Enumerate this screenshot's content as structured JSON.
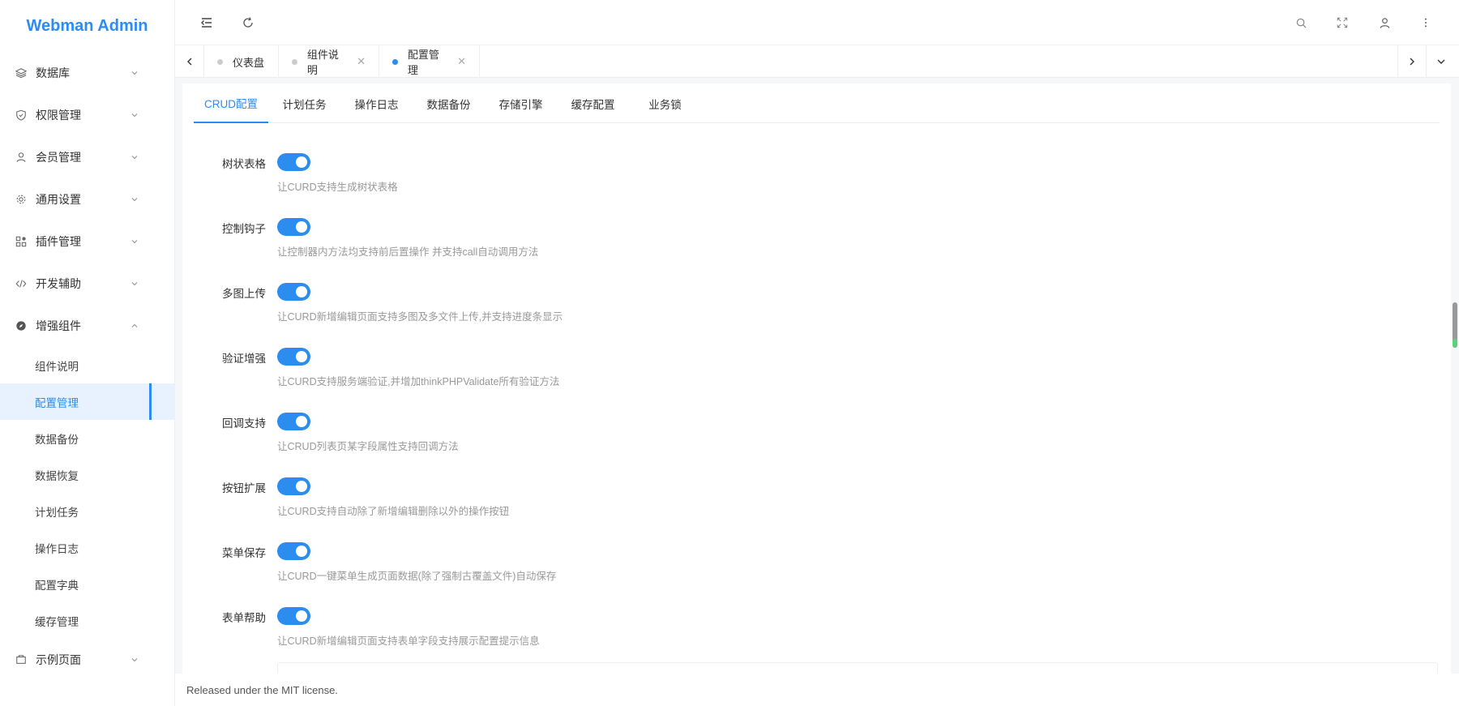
{
  "app": {
    "title": "Webman Admin"
  },
  "sidebar": {
    "items": [
      {
        "label": "数据库",
        "icon": "layers-icon"
      },
      {
        "label": "权限管理",
        "icon": "shield-icon"
      },
      {
        "label": "会员管理",
        "icon": "user-icon"
      },
      {
        "label": "通用设置",
        "icon": "gear-icon"
      },
      {
        "label": "插件管理",
        "icon": "plugin-icon"
      },
      {
        "label": "开发辅助",
        "icon": "code-icon"
      },
      {
        "label": "增强组件",
        "icon": "compass-icon"
      }
    ],
    "sub_items": [
      "组件说明",
      "配置管理",
      "数据备份",
      "数据恢复",
      "计划任务",
      "操作日志",
      "配置字典",
      "缓存管理"
    ],
    "last_item": {
      "label": "示例页面",
      "icon": "page-icon"
    }
  },
  "tabs": [
    {
      "label": "仪表盘",
      "closable": false
    },
    {
      "label": "组件说明",
      "closable": true
    },
    {
      "label": "配置管理",
      "closable": true,
      "active": true
    }
  ],
  "subtabs": [
    "CRUD配置",
    "计划任务",
    "操作日志",
    "数据备份",
    "存储引擎",
    "缓存配置",
    "业务锁"
  ],
  "settings": [
    {
      "label": "树状表格",
      "desc": "让CURD支持生成树状表格",
      "on": true
    },
    {
      "label": "控制钩子",
      "desc": "让控制器内方法均支持前后置操作 并支持call自动调用方法",
      "on": true
    },
    {
      "label": "多图上传",
      "desc": "让CURD新增编辑页面支持多图及多文件上传,并支持进度条显示",
      "on": true
    },
    {
      "label": "验证增强",
      "desc": "让CURD支持服务端验证,并增加thinkPHPValidate所有验证方法",
      "on": true
    },
    {
      "label": "回调支持",
      "desc": "让CRUD列表页某字段属性支持回调方法",
      "on": true
    },
    {
      "label": "按钮扩展",
      "desc": "让CURD支持自动除了新增编辑删除以外的操作按钮",
      "on": true
    },
    {
      "label": "菜单保存",
      "desc": "让CURD一键菜单生成页面数据(除了强制古覆盖文件)自动保存",
      "on": true
    },
    {
      "label": "表单帮助",
      "desc": "让CURD新增编辑页面支持表单字段支持展示配置提示信息",
      "on": true
    }
  ],
  "footer": {
    "text": "Released under the MIT license."
  },
  "colors": {
    "accent": "#2d8cf0",
    "active_bg": "#e8f2fe"
  }
}
